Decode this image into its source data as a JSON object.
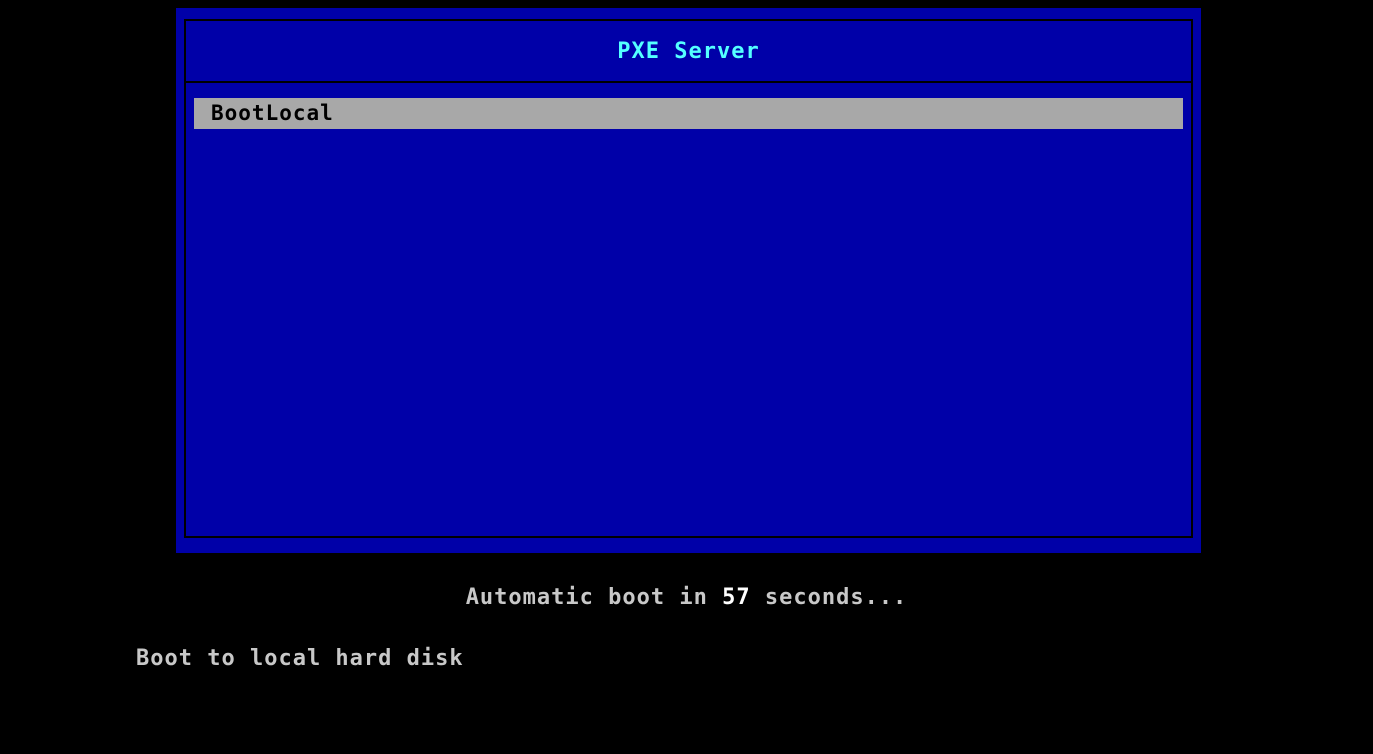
{
  "menu": {
    "title": "PXE Server",
    "items": [
      {
        "label": "BootLocal",
        "selected": true
      }
    ]
  },
  "countdown": {
    "prefix": "Automatic boot in ",
    "seconds": "57",
    "suffix": " seconds..."
  },
  "help": {
    "text": "Boot to local hard disk"
  },
  "colors": {
    "background": "#000000",
    "menu_background": "#0000a8",
    "title_text": "#54ffff",
    "selected_item_background": "#a8a8a8",
    "text": "#c8c8c8",
    "highlight_number": "#ffffff"
  }
}
